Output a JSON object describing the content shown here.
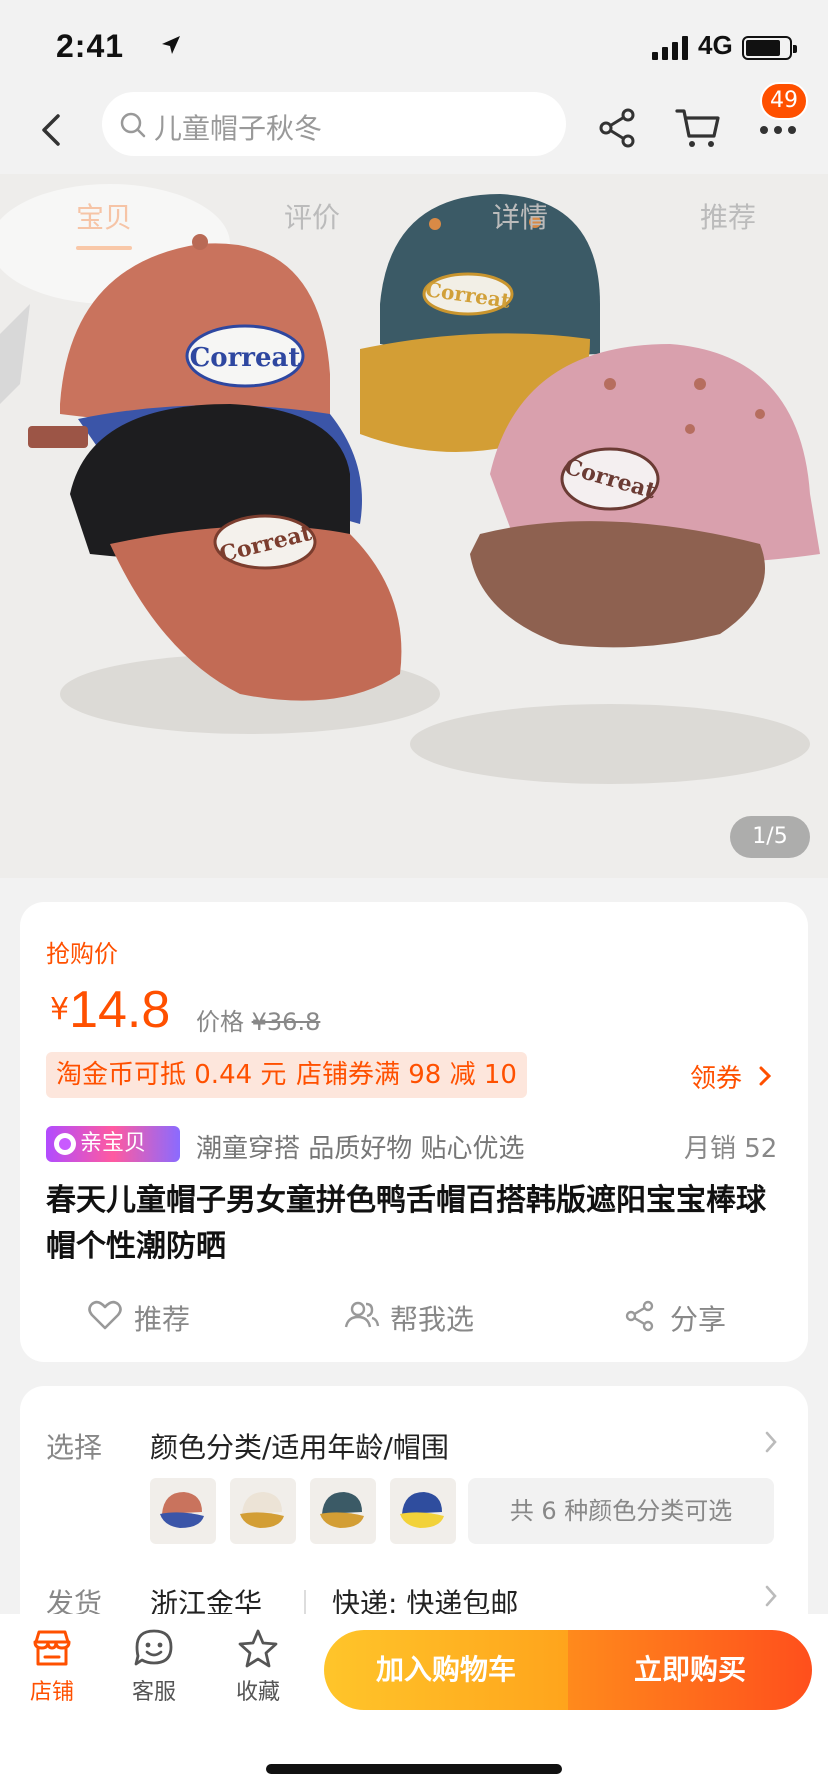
{
  "status_bar": {
    "time": "2:41",
    "network": "4G"
  },
  "nav": {
    "search_placeholder": "儿童帽子秋冬",
    "cart_badge": "49"
  },
  "gallery": {
    "tabs": [
      "宝贝",
      "评价",
      "详情",
      "推荐"
    ],
    "active_tab": "宝贝",
    "counter": "1/5",
    "hat_logo_text": "Correat"
  },
  "price_card": {
    "flash_label": "抢购价",
    "currency": "¥",
    "price": "14.8",
    "orig_label": "价格",
    "orig_price": "¥36.8",
    "chip_coins": "淘金币可抵 0.44 元",
    "chip_store": "店铺券满 98 减 10",
    "coupon_label": "领券",
    "tag_logo": "亲宝贝",
    "tagline": "潮童穿搭 品质好物 贴心优选",
    "monthly_sales": "月销 52",
    "title": "春天儿童帽子男女童拼色鸭舌帽百搭韩版遮阳宝宝棒球帽个性潮防晒",
    "actions": {
      "recommend": "推荐",
      "help_choose": "帮我选",
      "share": "分享"
    }
  },
  "options_card": {
    "select_label": "选择",
    "select_value": "颜色分类/适用年龄/帽围",
    "more_colors": "共 6 种颜色分类可选",
    "ship_label": "发货",
    "ship_origin": "浙江金华",
    "ship_express": "快递: 快递包邮"
  },
  "bottom_bar": {
    "store": "店铺",
    "service": "客服",
    "favorite": "收藏",
    "add_to_cart": "加入购物车",
    "buy_now": "立即购买"
  },
  "colors": {
    "accent": "#ff5000"
  }
}
